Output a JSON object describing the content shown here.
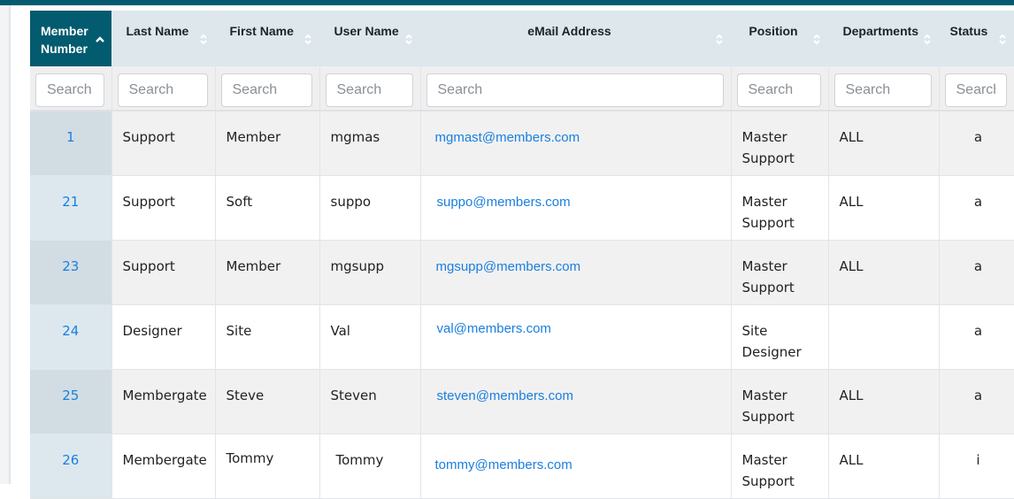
{
  "colors": {
    "header_active": "#035b6f",
    "header_bg": "#dde7ec",
    "link": "#1a7fe0"
  },
  "columns": [
    {
      "label": "Member\nNumber",
      "line1": "Member",
      "line2": "Number",
      "sort": "ascending",
      "search_placeholder": "Search"
    },
    {
      "label": "Last Name",
      "sort": "none",
      "search_placeholder": "Search"
    },
    {
      "label": "First Name",
      "sort": "none",
      "search_placeholder": "Search"
    },
    {
      "label": "User Name",
      "sort": "none",
      "search_placeholder": "Search"
    },
    {
      "label": "eMail Address",
      "sort": "none",
      "search_placeholder": "Search"
    },
    {
      "label": "Position",
      "sort": "none",
      "search_placeholder": "Search"
    },
    {
      "label": "Departments",
      "sort": "none",
      "search_placeholder": "Search"
    },
    {
      "label": "Status",
      "sort": "none",
      "search_placeholder": "Search"
    }
  ],
  "rows": [
    {
      "member_number": "1",
      "last_name": "Support",
      "first_name": "Member",
      "user_name": "mgmas",
      "email": "mgmast@members.com",
      "position": "Master Support",
      "departments": "ALL",
      "status": "a"
    },
    {
      "member_number": "21",
      "last_name": "Support",
      "first_name": "Soft",
      "user_name": "suppo",
      "email": "suppo@members.com",
      "position": "Master Support",
      "departments": "ALL",
      "status": "a"
    },
    {
      "member_number": "23",
      "last_name": "Support",
      "first_name": "Member",
      "user_name": "mgsupp",
      "email": "mgsupp@members.com",
      "position": "Master Support",
      "departments": "ALL",
      "status": "a"
    },
    {
      "member_number": "24",
      "last_name": "Designer",
      "first_name": "Site",
      "user_name": "Val",
      "email": "val@members.com",
      "position": "Site Designer",
      "departments": "",
      "status": "a"
    },
    {
      "member_number": "25",
      "last_name": "Membergate",
      "first_name": "Steve",
      "user_name": "Steven",
      "email": "steven@members.com",
      "position": "Master Support",
      "departments": "ALL",
      "status": "a"
    },
    {
      "member_number": "26",
      "last_name": "Membergate",
      "first_name": "Tommy",
      "user_name": "Tommy",
      "email": "tommy@members.com",
      "position": "Master Support",
      "departments": "ALL",
      "status": "i"
    }
  ]
}
